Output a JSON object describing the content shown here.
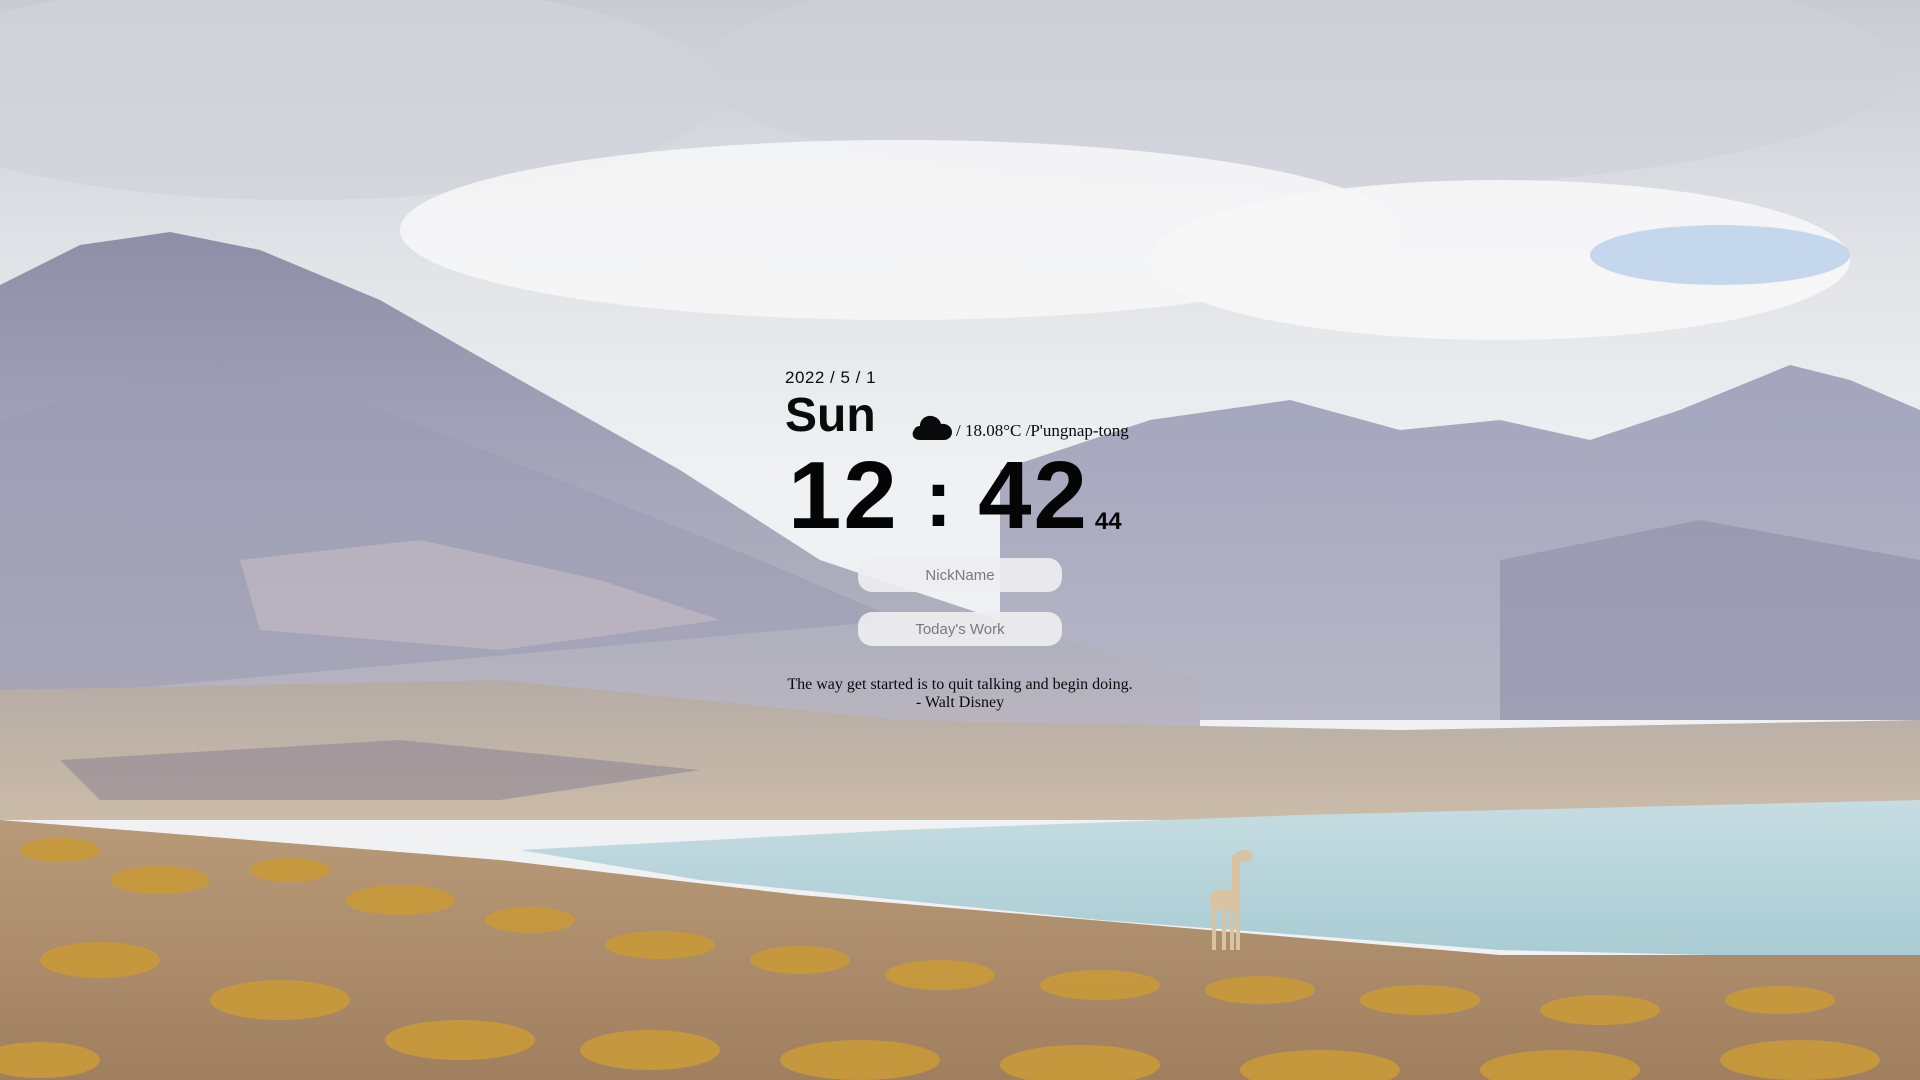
{
  "date": {
    "ymd": "2022 / 5 / 1",
    "weekday": "Sun"
  },
  "weather": {
    "icon": "cloud-icon",
    "text": "/ 18.08°C /P'ungnap-tong"
  },
  "clock": {
    "hours": "12",
    "separator": ":",
    "minutes": "42",
    "seconds": "44"
  },
  "inputs": {
    "nickname_placeholder": "NickName",
    "todays_work_placeholder": "Today's Work"
  },
  "quote": {
    "text": "The way get started is to quit talking and begin doing.",
    "author": "- Walt Disney"
  },
  "colors": {
    "text": "#0a0a0a",
    "input_bg": "#eeeef0",
    "lake": "#b8d6dd",
    "grass": "#c69a3c"
  }
}
